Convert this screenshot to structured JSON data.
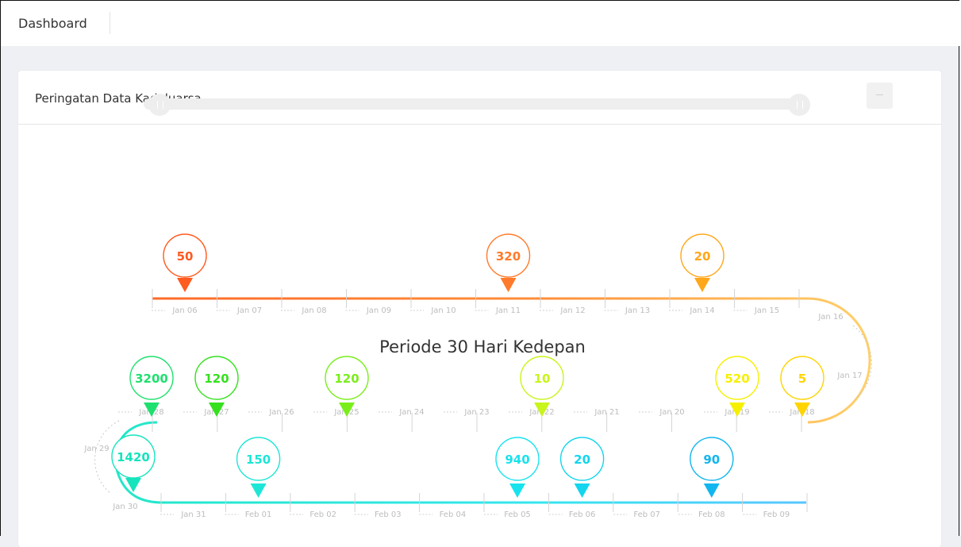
{
  "header": {
    "title": "Dashboard"
  },
  "card": {
    "title": "Peringatan Data Kadaluarsa"
  },
  "chart_data": {
    "type": "timeline",
    "title": "Periode 30 Hari Kedepan",
    "axis_labels": [
      "Jan 06",
      "Jan 07",
      "Jan 08",
      "Jan 09",
      "Jan 10",
      "Jan 11",
      "Jan 12",
      "Jan 13",
      "Jan 14",
      "Jan 15",
      "Jan 16",
      "Jan 17",
      "Jan 18",
      "Jan 19",
      "Jan 20",
      "Jan 21",
      "Jan 22",
      "Jan 23",
      "Jan 24",
      "Jan 25",
      "Jan 26",
      "Jan 27",
      "Jan 28",
      "Jan 29",
      "Jan 30",
      "Jan 31",
      "Feb 01",
      "Feb 02",
      "Feb 03",
      "Feb 04",
      "Feb 05",
      "Feb 06",
      "Feb 07",
      "Feb 08",
      "Feb 09"
    ],
    "markers": [
      {
        "date": "Jan 06",
        "value": 50,
        "color": "#ff5a1f"
      },
      {
        "date": "Jan 11",
        "value": 320,
        "color": "#ff7a2a"
      },
      {
        "date": "Jan 14",
        "value": 20,
        "color": "#ffa71a"
      },
      {
        "date": "Jan 19",
        "value": 520,
        "color": "#f6f000"
      },
      {
        "date": "Jan 18",
        "value": 5,
        "color": "#ffd400"
      },
      {
        "date": "Jan 22",
        "value": 10,
        "color": "#c8f51c"
      },
      {
        "date": "Jan 25",
        "value": 120,
        "color": "#7aee1a"
      },
      {
        "date": "Jan 27",
        "value": 120,
        "color": "#35e01e"
      },
      {
        "date": "Jan 28",
        "value": 3200,
        "color": "#1ee06f"
      },
      {
        "date": "Jan 30",
        "value": 1420,
        "color": "#15e4bd"
      },
      {
        "date": "Feb 01",
        "value": 150,
        "color": "#1ee6d6"
      },
      {
        "date": "Feb 05",
        "value": 940,
        "color": "#17e3ee"
      },
      {
        "date": "Feb 06",
        "value": 20,
        "color": "#14d5ee"
      },
      {
        "date": "Feb 08",
        "value": 90,
        "color": "#12b6ee"
      }
    ]
  }
}
